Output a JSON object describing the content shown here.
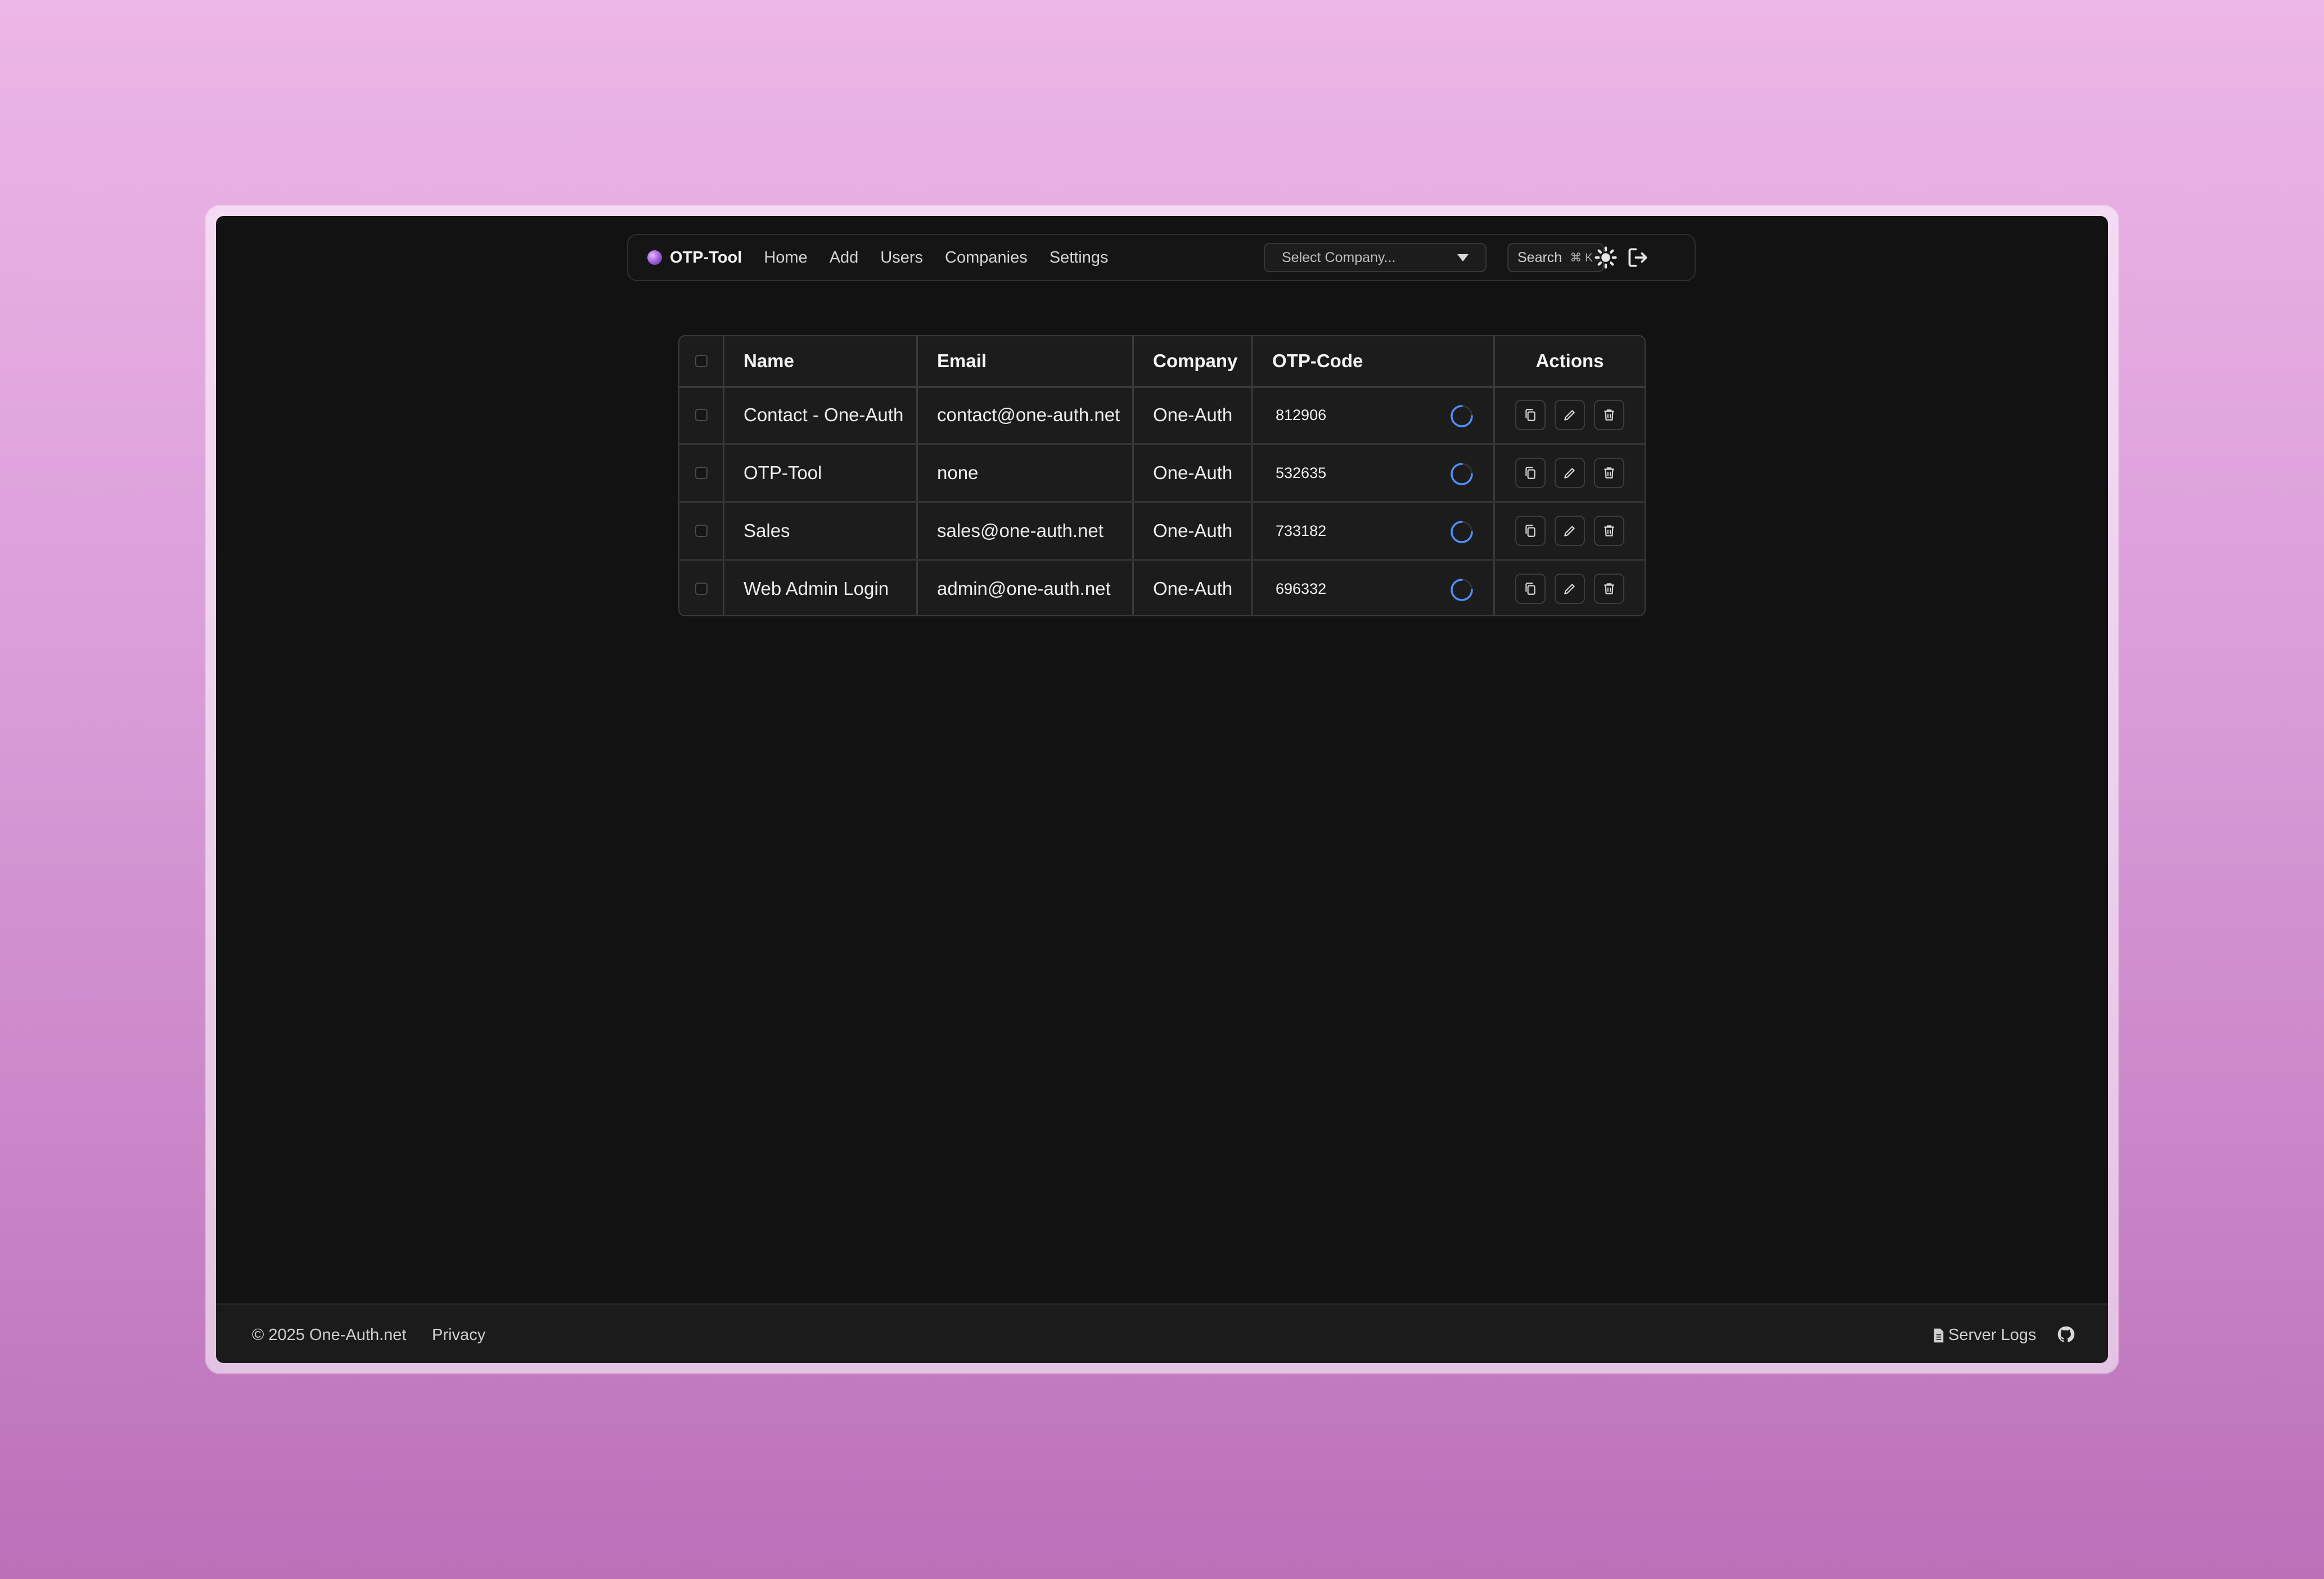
{
  "nav": {
    "brand": "OTP-Tool",
    "links": [
      "Home",
      "Add",
      "Users",
      "Companies",
      "Settings"
    ],
    "select_company_placeholder": "Select Company...",
    "search_label": "Search",
    "search_shortcut": "⌘ K"
  },
  "table": {
    "headers": [
      "Name",
      "Email",
      "Company",
      "OTP-Code",
      "Actions"
    ],
    "rows": [
      {
        "name": "Contact - One-Auth",
        "email": "contact@one-auth.net",
        "company": "One-Auth",
        "otp": "812906"
      },
      {
        "name": "OTP-Tool",
        "email": "none",
        "company": "One-Auth",
        "otp": "532635"
      },
      {
        "name": "Sales",
        "email": "sales@one-auth.net",
        "company": "One-Auth",
        "otp": "733182"
      },
      {
        "name": "Web Admin Login",
        "email": "admin@one-auth.net",
        "company": "One-Auth",
        "otp": "696332"
      }
    ],
    "actions": [
      "copy-icon",
      "edit-icon",
      "trash-icon"
    ]
  },
  "footer": {
    "copyright": "© 2025 One-Auth.net",
    "privacy": "Privacy",
    "server_logs": "Server Logs"
  },
  "colors": {
    "background_top": "#ecb6e6",
    "background_bottom": "#bb70b8",
    "app_bg": "#121212",
    "spinner": "#4f8ff7"
  }
}
